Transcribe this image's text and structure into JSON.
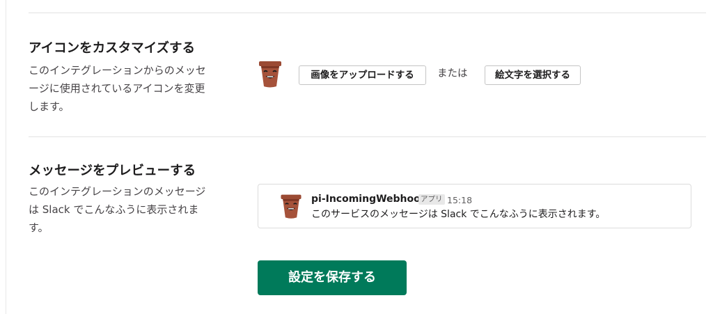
{
  "customize_icon": {
    "title": "アイコンをカスタマイズする",
    "desc_lines": [
      "このインテグレーションからのメッセ",
      "ージに使用されているアイコンを変更",
      "します。"
    ],
    "upload_button": "画像をアップロードする",
    "or_text": "または",
    "emoji_button": "絵文字を選択する",
    "icon": "flowerpot-face-icon"
  },
  "preview": {
    "title": "メッセージをプレビューする",
    "desc_lines": [
      "このインテグレーションのメッセージ",
      "は Slack でこんなふうに表示されま",
      "す。"
    ],
    "bot_name": "pi-IncomingWebhooks",
    "badge": "アプリ",
    "time": "15:18",
    "message": "このサービスのメッセージは Slack でこんなふうに表示されます。"
  },
  "save_button": "設定を保存する",
  "colors": {
    "save_button_bg": "#007a5a",
    "pot": "#a5523a"
  }
}
